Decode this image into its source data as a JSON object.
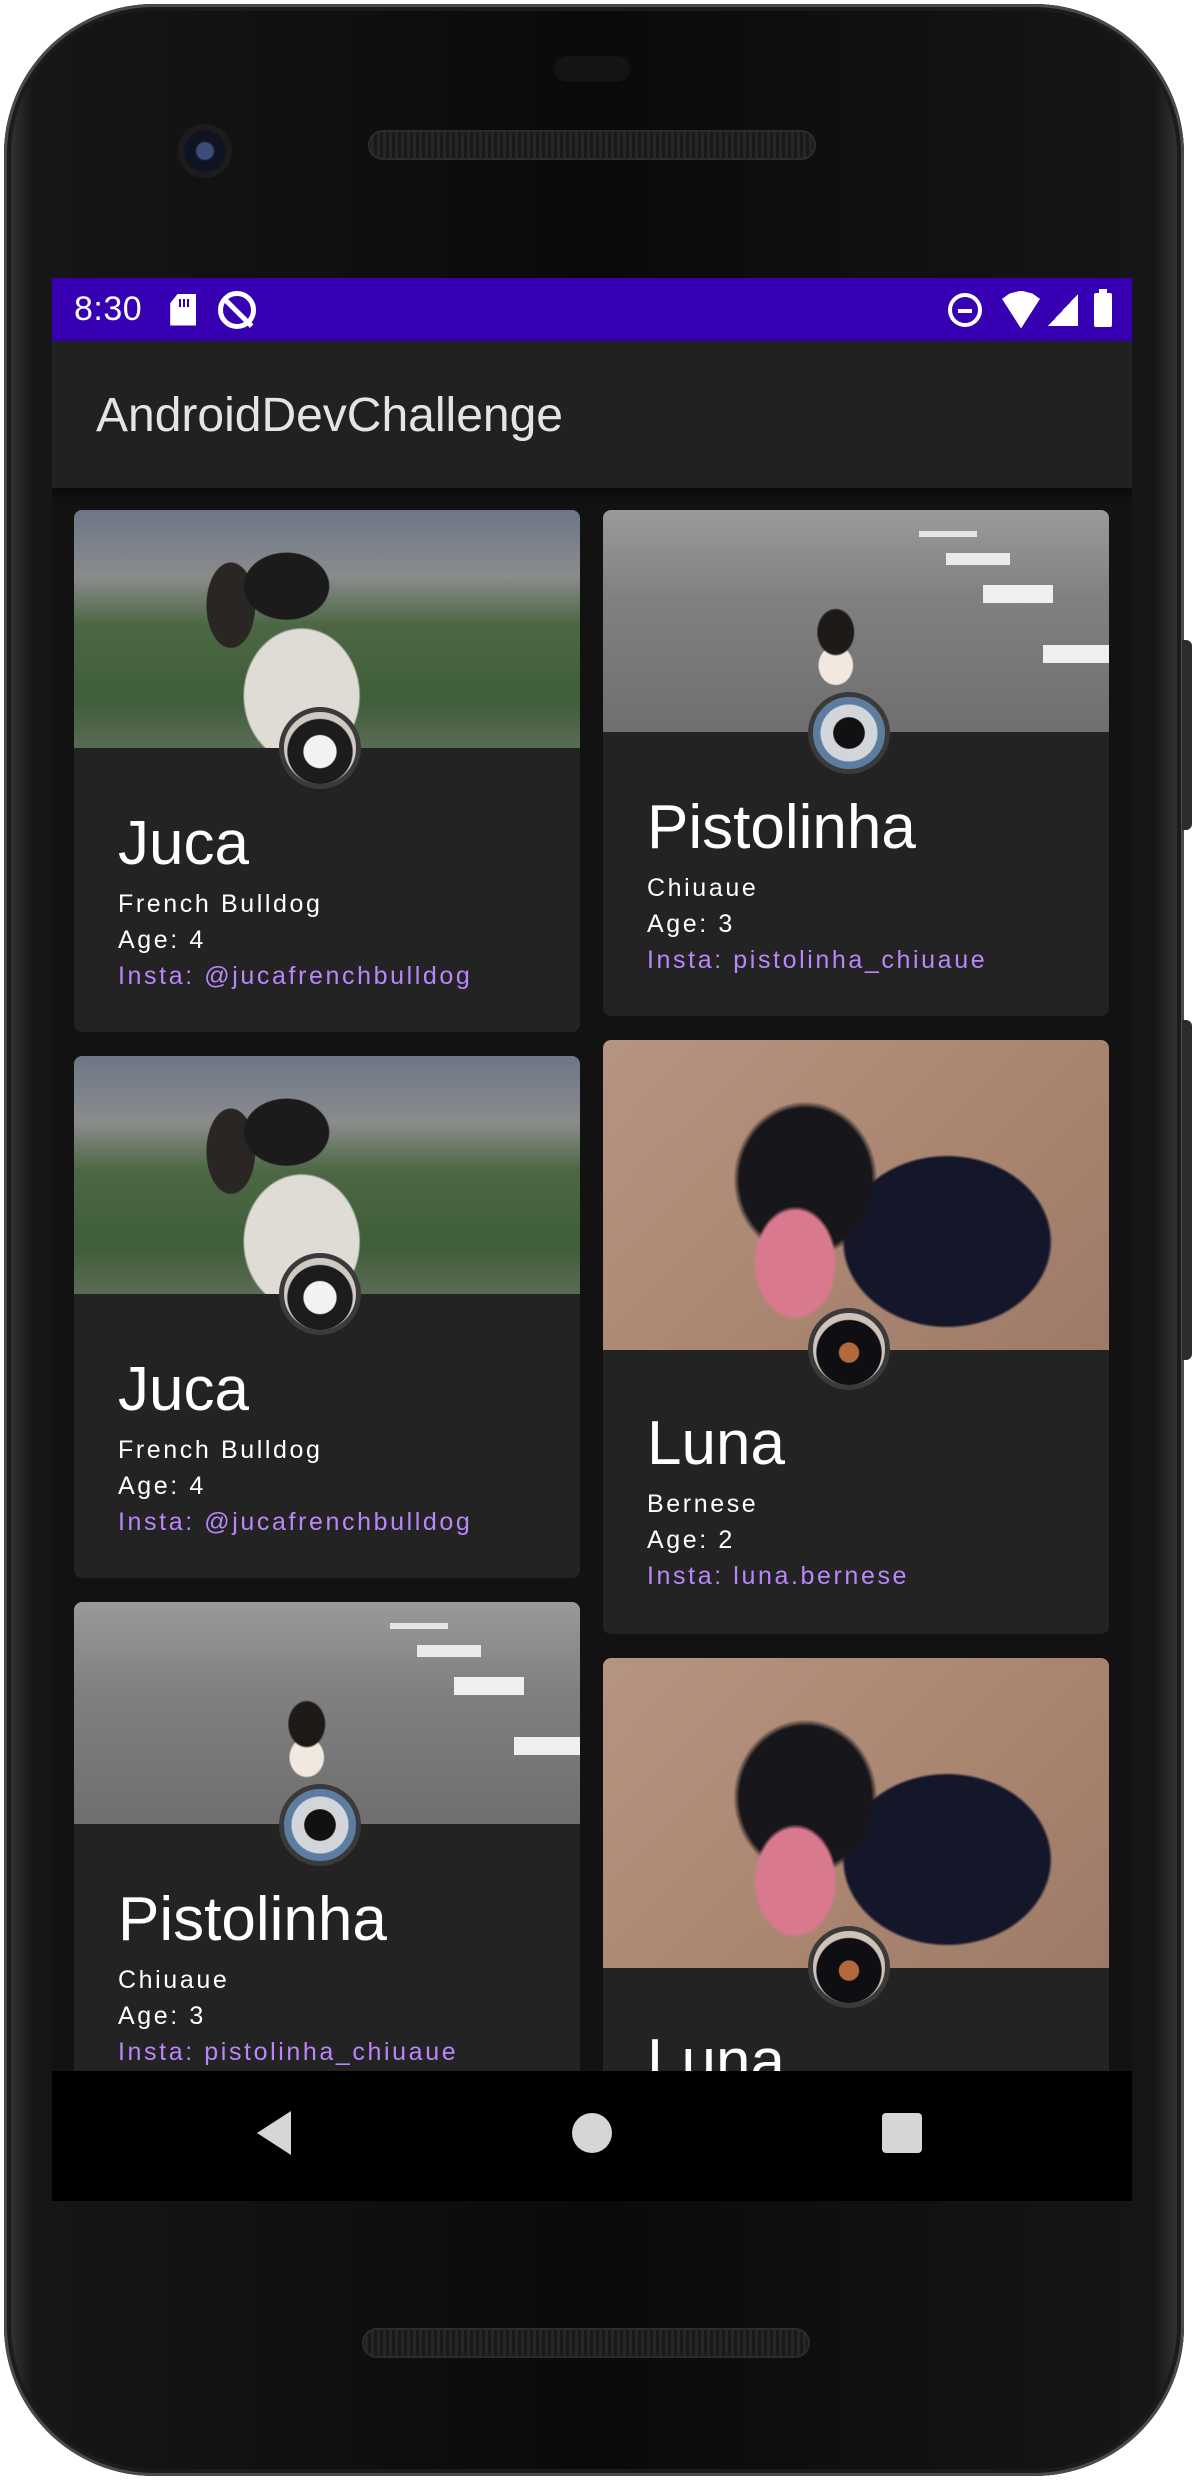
{
  "status_bar": {
    "time": "8:30",
    "icons": [
      "sd-card-icon",
      "no-sync-icon",
      "do-not-disturb-icon",
      "wifi-icon",
      "signal-icon",
      "battery-icon"
    ],
    "background": "#3700b3"
  },
  "app_bar": {
    "title": "AndroidDevChallenge",
    "background": "#212121"
  },
  "colors": {
    "card": "#232323",
    "accent": "#bb86fc",
    "screen": "#121212"
  },
  "pets": {
    "left": [
      {
        "name": "Juca",
        "breed": "French Bulldog",
        "age": "Age: 4",
        "insta": "Insta: @jucafrenchbulldog",
        "photo": "bulldog-photo"
      },
      {
        "name": "Juca",
        "breed": "French Bulldog",
        "age": "Age: 4",
        "insta": "Insta: @jucafrenchbulldog",
        "photo": "bulldog-photo"
      },
      {
        "name": "Pistolinha",
        "breed": "Chiuaue",
        "age": "Age: 3",
        "insta": "Insta: pistolinha_chiuaue",
        "photo": "chihuahua-photo"
      }
    ],
    "right": [
      {
        "name": "Pistolinha",
        "breed": "Chiuaue",
        "age": "Age: 3",
        "insta": "Insta: pistolinha_chiuaue",
        "photo": "chihuahua-photo"
      },
      {
        "name": "Luna",
        "breed": "Bernese",
        "age": "Age: 2",
        "insta": "Insta: luna.bernese",
        "photo": "bernese-photo"
      },
      {
        "name": "Luna",
        "photo": "bernese-photo"
      }
    ]
  },
  "nav_bar": {
    "buttons": [
      "back-icon",
      "home-icon",
      "recents-icon"
    ]
  }
}
